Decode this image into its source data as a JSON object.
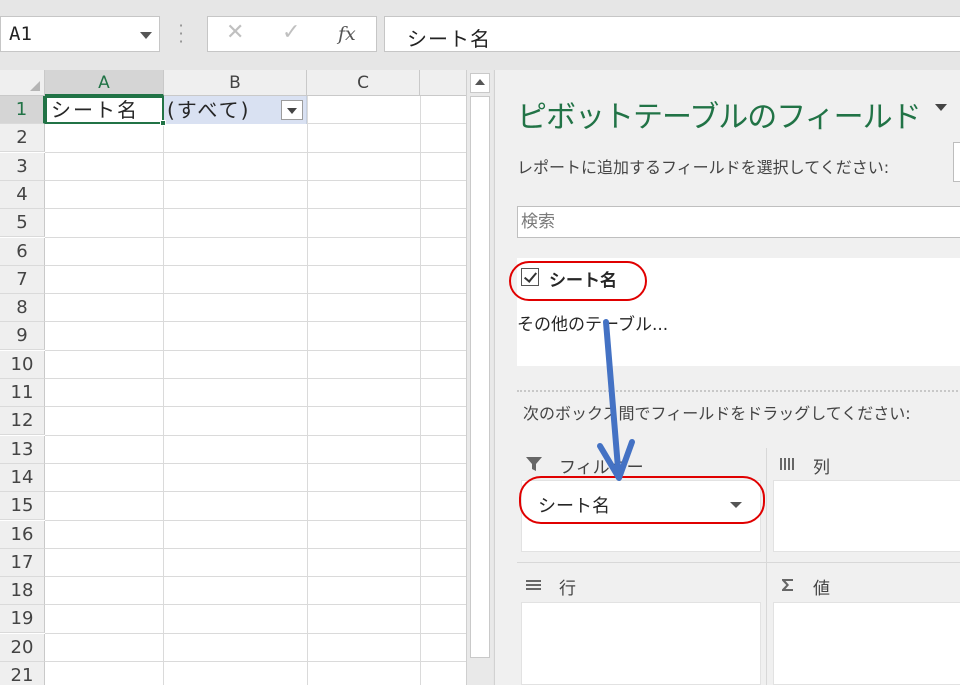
{
  "formula_bar": {
    "name_box": "A1",
    "fx_label": "fx",
    "formula_value": "シート名"
  },
  "grid": {
    "columns": [
      "A",
      "B",
      "C"
    ],
    "rows": [
      "1",
      "2",
      "3",
      "4",
      "5",
      "6",
      "7",
      "8",
      "9",
      "10",
      "11",
      "12",
      "13",
      "14",
      "15",
      "16",
      "17",
      "18",
      "19",
      "20",
      "21"
    ],
    "cell_a1": "シート名",
    "cell_b1": "(すべて)"
  },
  "pivot_pane": {
    "title": "ピボットテーブルのフィールド",
    "subtitle": "レポートに追加するフィールドを選択してください:",
    "search_placeholder": "検索",
    "field_name": "シート名",
    "more_tables": "その他のテーブル...",
    "drag_hint": "次のボックス間でフィールドをドラッグしてください:",
    "areas": {
      "filter": "フィルター",
      "columns": "列",
      "rows": "行",
      "values": "値"
    },
    "filter_field": "シート名"
  },
  "colors": {
    "excel_green": "#217346",
    "annotation_red": "#e00000",
    "annotation_arrow": "#4472c4",
    "selection_fill": "#d9e1f2"
  }
}
